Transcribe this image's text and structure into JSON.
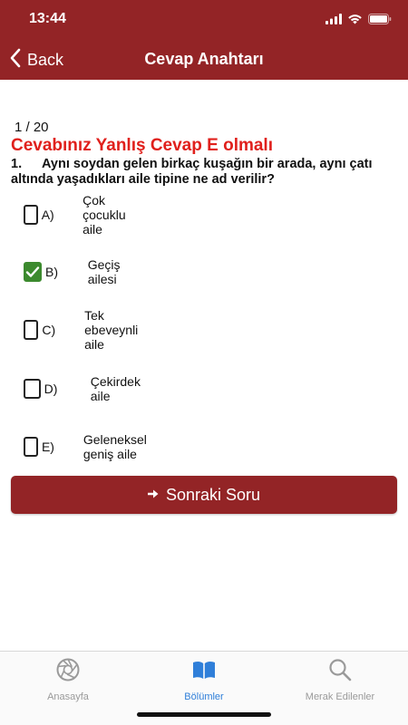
{
  "status": {
    "time": "13:44"
  },
  "nav": {
    "back_label": "Back",
    "title": "Cevap Anahtarı"
  },
  "quiz": {
    "progress": "1 / 20",
    "result_text": "Cevabınız Yanlış Cevap E olmalı",
    "question_number": "1.",
    "question_text": "Aynı soydan gelen birkaç kuşağın bir arada, aynı çatı altında yaşadıkları aile tipine ne ad verilir?",
    "options": [
      {
        "letter": "A)",
        "text": "Çok çocuklu aile",
        "checked": false
      },
      {
        "letter": "B)",
        "text": "Geçiş ailesi",
        "checked": true
      },
      {
        "letter": "C)",
        "text": "Tek ebeveynli aile",
        "checked": false
      },
      {
        "letter": "D)",
        "text": "Çekirdek aile",
        "checked": false
      },
      {
        "letter": "E)",
        "text": "Geleneksel geniş aile",
        "checked": false
      }
    ],
    "next_label": "Sonraki Soru"
  },
  "tabs": [
    {
      "label": "Anasayfa",
      "icon": "aperture-icon",
      "active": false
    },
    {
      "label": "Bölümler",
      "icon": "book-icon",
      "active": true
    },
    {
      "label": "Merak Edilenler",
      "icon": "search-icon",
      "active": false
    }
  ],
  "colors": {
    "brand": "#932426",
    "error": "#e0201c",
    "checked": "#3c8a2e",
    "tab_active": "#2f7fd9",
    "tab_inactive": "#9a9a9a"
  }
}
